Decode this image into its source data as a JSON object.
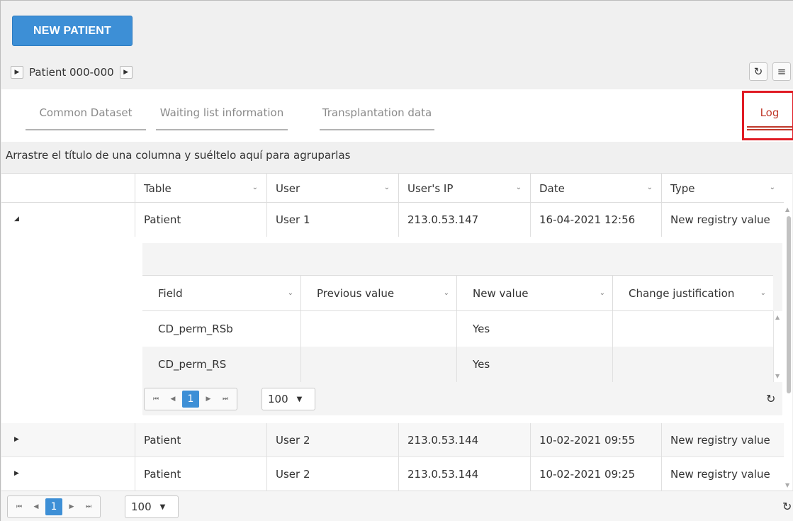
{
  "toolbar": {
    "new_patient_label": "NEW PATIENT"
  },
  "patient_nav": {
    "label": "Patient 000-000",
    "prev_icon": "triangle-right-icon",
    "next_icon": "triangle-right-icon"
  },
  "top_tools": {
    "refresh_icon": "refresh-icon",
    "menu_icon": "list-icon"
  },
  "tabs": [
    {
      "label": "Common Dataset",
      "active": false
    },
    {
      "label": "Waiting list information",
      "active": false
    },
    {
      "label": "Transplantation data",
      "active": false
    },
    {
      "label": "Log",
      "active": true
    }
  ],
  "group_hint": "Arrastre el título de una columna y suéltelo aquí para agruparlas",
  "grid": {
    "columns": [
      "Table",
      "User",
      "User's IP",
      "Date",
      "Type"
    ],
    "rows": [
      {
        "table": "Patient",
        "user": "User 1",
        "ip": "213.0.53.147",
        "date": "16-04-2021 12:56",
        "type": "New registry value",
        "expanded": true
      },
      {
        "table": "Patient",
        "user": "User 2",
        "ip": "213.0.53.144",
        "date": "10-02-2021 09:55",
        "type": "New registry value",
        "expanded": false
      },
      {
        "table": "Patient",
        "user": "User 2",
        "ip": "213.0.53.144",
        "date": "10-02-2021 09:25",
        "type": "New registry value",
        "expanded": false
      }
    ],
    "pager": {
      "current_page": "1",
      "page_size": "100"
    }
  },
  "detail": {
    "columns": [
      "Field",
      "Previous value",
      "New value",
      "Change justification"
    ],
    "rows": [
      {
        "field": "CD_perm_RSb",
        "previous": "",
        "new": "Yes",
        "justification": ""
      },
      {
        "field": "CD_perm_RS",
        "previous": "",
        "new": "Yes",
        "justification": ""
      }
    ],
    "pager": {
      "current_page": "1",
      "page_size": "100"
    }
  },
  "colors": {
    "primary": "#3d8fd6",
    "active_tab": "#c0392b",
    "highlight_box": "#e01b24"
  }
}
